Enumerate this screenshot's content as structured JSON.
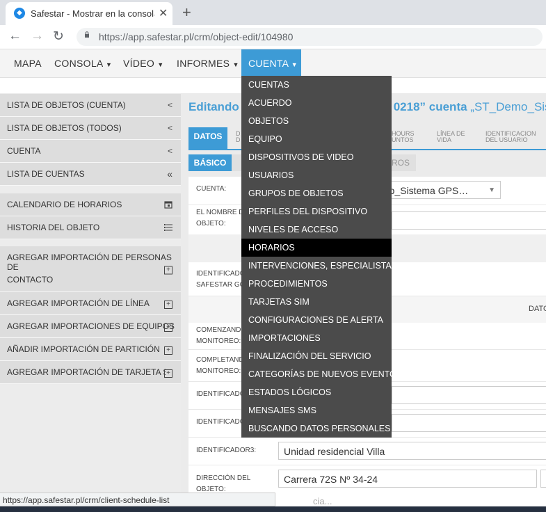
{
  "browser": {
    "tab_title": "Safestar - Mostrar en la consola",
    "url_host": "https://app.safestar.pl",
    "url_path": "/crm/object-edit/104980",
    "status_url": "https://app.safestar.pl/crm/client-schedule-list"
  },
  "nav": {
    "items": [
      {
        "label": "MAPA"
      },
      {
        "label": "CONSOLA"
      },
      {
        "label": "VÍDEO"
      },
      {
        "label": "INFORMES"
      },
      {
        "label": "CUENTA"
      }
    ]
  },
  "dropdown": {
    "items": [
      "CUENTAS",
      "ACUERDO",
      "OBJETOS",
      "EQUIPO",
      "DISPOSITIVOS DE VIDEO",
      "USUARIOS",
      "GRUPOS DE OBJETOS",
      "PERFILES DEL DISPOSITIVO",
      "NIVELES DE ACCESO",
      "HORARIOS",
      "INTERVENCIONES, ESPECIALISTAS",
      "PROCEDIMIENTOS",
      "TARJETAS SIM",
      "CONFIGURACIONES DE ALERTA",
      "IMPORTACIONES",
      "FINALIZACIÓN DEL SERVICIO",
      "CATEGORÍAS DE NUEVOS EVENTOS",
      "ESTADOS LÓGICOS",
      "MENSAJES SMS",
      "BUSCANDO DATOS PERSONALES"
    ],
    "active_index": 9
  },
  "sidebar": {
    "items": [
      {
        "label": "LISTA DE OBJETOS (CUENTA)",
        "icon": "chevron-left-icon"
      },
      {
        "label": "LISTA DE OBJETOS (TODOS)",
        "icon": "chevron-left-icon"
      },
      {
        "label": "CUENTA",
        "icon": "chevron-left-icon"
      },
      {
        "label": "LISTA DE CUENTAS",
        "icon": "double-chevron-left-icon"
      },
      {
        "label": "CALENDARIO DE HORARIOS",
        "icon": "calendar-icon"
      },
      {
        "label": "HISTORIA DEL OBJETO",
        "icon": "list-icon"
      },
      {
        "label": "AGREGAR IMPORTACIÓN DE PERSONAS DE",
        "label2": "CONTACTO",
        "icon": "plus-box-icon"
      },
      {
        "label": "AGREGAR IMPORTACIÓN DE LÍNEA",
        "icon": "plus-box-icon"
      },
      {
        "label": "AGREGAR IMPORTACIONES DE EQUIPOS",
        "icon": "plus-box-icon"
      },
      {
        "label": "AÑADIR IMPORTACIÓN DE PARTICIÓN",
        "icon": "plus-box-icon"
      },
      {
        "label": "AGREGAR IMPORTACIÓN DE TARJETA SIM",
        "icon": "plus-box-icon"
      }
    ]
  },
  "main": {
    "title_start": "Editando",
    "title_mid": "0218” cuenta",
    "title_account": "„ST_Demo_Siste",
    "tabs_top": {
      "datos": "DATOS",
      "d": "D",
      "d2": "D",
      "hours_a": "HOURS",
      "hours_b": "UNTOS",
      "linea_a": "LÍNEA DE",
      "linea_b": "VIDA",
      "ident_a": "IDENTIFICACION",
      "ident_b": "DEL USUARIO"
    },
    "tabs_sub": {
      "basico": "BÁSICO",
      "ros": "ROS"
    },
    "form": {
      "cuenta_label": "CUENTA:",
      "cuenta_value": "mo_Sistema GPS…",
      "nombre_label_a": "EL NOMBRE D",
      "nombre_label_b": "OBJETO:",
      "ident_gps_a": "IDENTIFICADO",
      "ident_gps_b": "SAFESTAR GO",
      "dato": "DATO",
      "comenzando_a": "COMENZANDO",
      "comenzando_b": "MONITOREO:",
      "completando_a": "COMPLETAND",
      "completando_b": "MONITOREO:",
      "ident1": "IDENTIFICADO",
      "ident2": "IDENTIFICADO",
      "ident3_label": "IDENTIFICADOR3:",
      "ident3_value": "Unidad residencial Villa",
      "direccion_label_a": "DIRECCIÓN DEL",
      "direccion_label_b": "OBJETO:",
      "direccion_value": "Carrera 72S Nº 34-24",
      "bottom_hint": "cia..."
    }
  },
  "colors": {
    "accent": "#3d9bd6",
    "dropdown_bg": "#4b4b4b",
    "dropdown_active": "#000000"
  }
}
